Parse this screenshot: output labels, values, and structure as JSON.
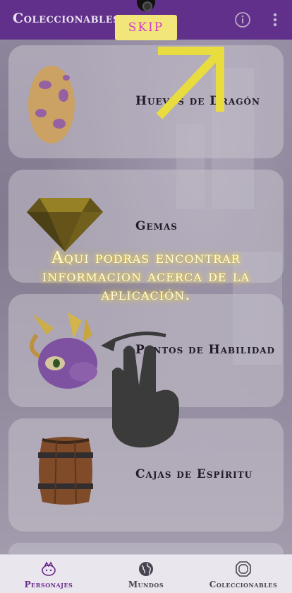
{
  "app_bar": {
    "title": "Coleccionables",
    "info_icon": "info-circle-icon",
    "menu_icon": "more-vert-icon",
    "color": "#61308a"
  },
  "tutorial": {
    "skip_label": "SKIP",
    "message": "Aqui podras encontrar informacion acerca de la aplicación.",
    "arrow_icon": "arrow-up-right-icon",
    "hand_icon": "swipe-hand-icon",
    "accent": "#f2e57a"
  },
  "collectibles": [
    {
      "label": "Huevos de Dragón",
      "icon": "dragon-egg-icon"
    },
    {
      "label": "Gemas",
      "icon": "gem-icon"
    },
    {
      "label": "Puntos de Habilidad",
      "icon": "spyro-head-icon"
    },
    {
      "label": "Cajas de Espíritu",
      "icon": "barrel-icon"
    }
  ],
  "bottom_nav": {
    "items": [
      {
        "label": "Personajes",
        "icon": "character-icon",
        "active": true
      },
      {
        "label": "Mundos",
        "icon": "globe-icon",
        "active": false
      },
      {
        "label": "Coleccionables",
        "icon": "gem-outline-icon",
        "active": false
      }
    ]
  }
}
